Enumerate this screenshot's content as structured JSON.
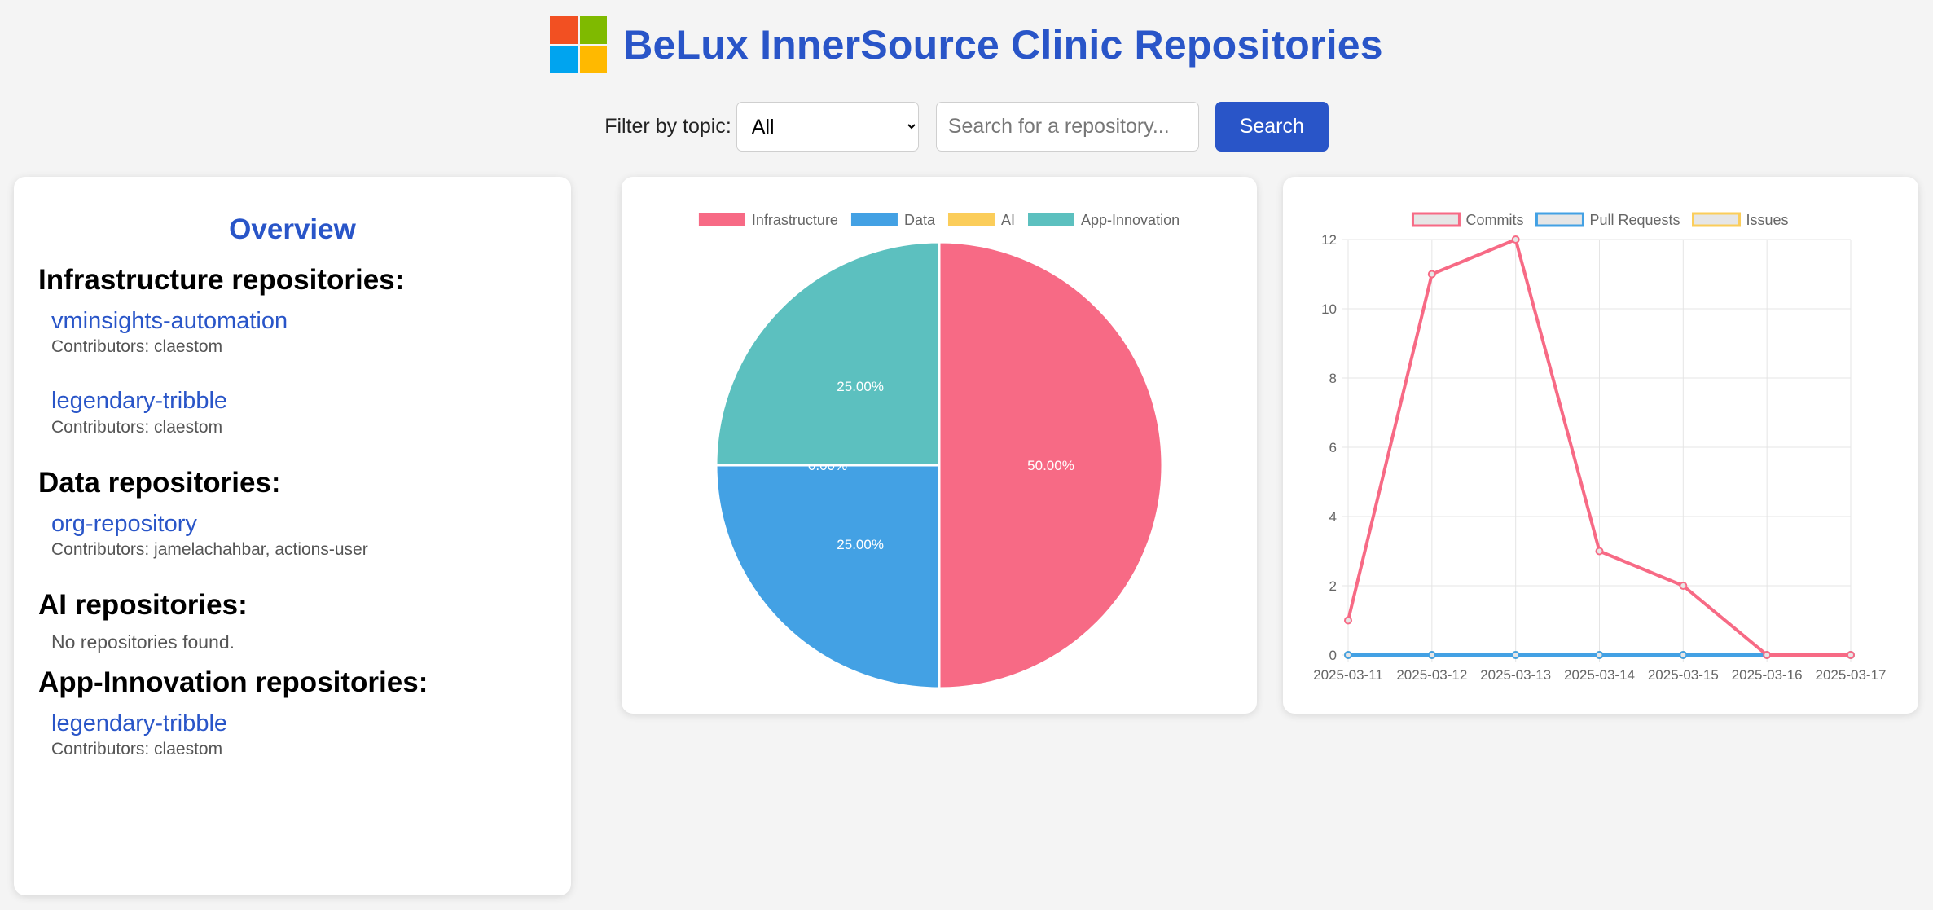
{
  "header": {
    "title": "BeLux InnerSource Clinic Repositories",
    "logo_colors": [
      "#f25022",
      "#7fba00",
      "#00a4ef",
      "#ffb900"
    ]
  },
  "filter": {
    "label": "Filter by topic:",
    "selected": "All",
    "search_placeholder": "Search for a repository...",
    "search_button": "Search"
  },
  "overview": {
    "title": "Overview",
    "sections": [
      {
        "heading": "Infrastructure repositories:",
        "repos": [
          {
            "name": "vminsights-automation",
            "contributors": "Contributors: claestom"
          },
          {
            "name": "legendary-tribble",
            "contributors": "Contributors: claestom"
          }
        ]
      },
      {
        "heading": "Data repositories:",
        "repos": [
          {
            "name": "org-repository",
            "contributors": "Contributors: jamelachahbar, actions-user"
          }
        ]
      },
      {
        "heading": "AI repositories:",
        "empty_text": "No repositories found.",
        "repos": []
      },
      {
        "heading": "App-Innovation repositories:",
        "repos": [
          {
            "name": "legendary-tribble",
            "contributors": "Contributors: claestom"
          }
        ]
      }
    ]
  },
  "chart_data": [
    {
      "type": "pie",
      "legend_position": "top",
      "categories": [
        "Infrastructure",
        "Data",
        "AI",
        "App-Innovation"
      ],
      "values": [
        50,
        25,
        0,
        25
      ],
      "labels": [
        "50.00%",
        "25.00%",
        "0.00%",
        "25.00%"
      ],
      "colors": [
        "#f76a85",
        "#43a1e4",
        "#fbcd5a",
        "#5cc0bf"
      ]
    },
    {
      "type": "line",
      "legend_position": "top",
      "x": [
        "2025-03-11",
        "2025-03-12",
        "2025-03-13",
        "2025-03-14",
        "2025-03-15",
        "2025-03-16",
        "2025-03-17"
      ],
      "ylim": [
        0,
        12
      ],
      "yticks": [
        0,
        2,
        4,
        6,
        8,
        10,
        12
      ],
      "grid": true,
      "series": [
        {
          "name": "Commits",
          "values": [
            1,
            11,
            12,
            3,
            2,
            0,
            0
          ],
          "color": "#f76a85"
        },
        {
          "name": "Pull Requests",
          "values": [
            0,
            0,
            0,
            0,
            0,
            0,
            0
          ],
          "color": "#43a1e4"
        },
        {
          "name": "Issues",
          "values": [
            0,
            0,
            0,
            0,
            0,
            0,
            0
          ],
          "color": "#fbcd5a"
        }
      ]
    }
  ]
}
